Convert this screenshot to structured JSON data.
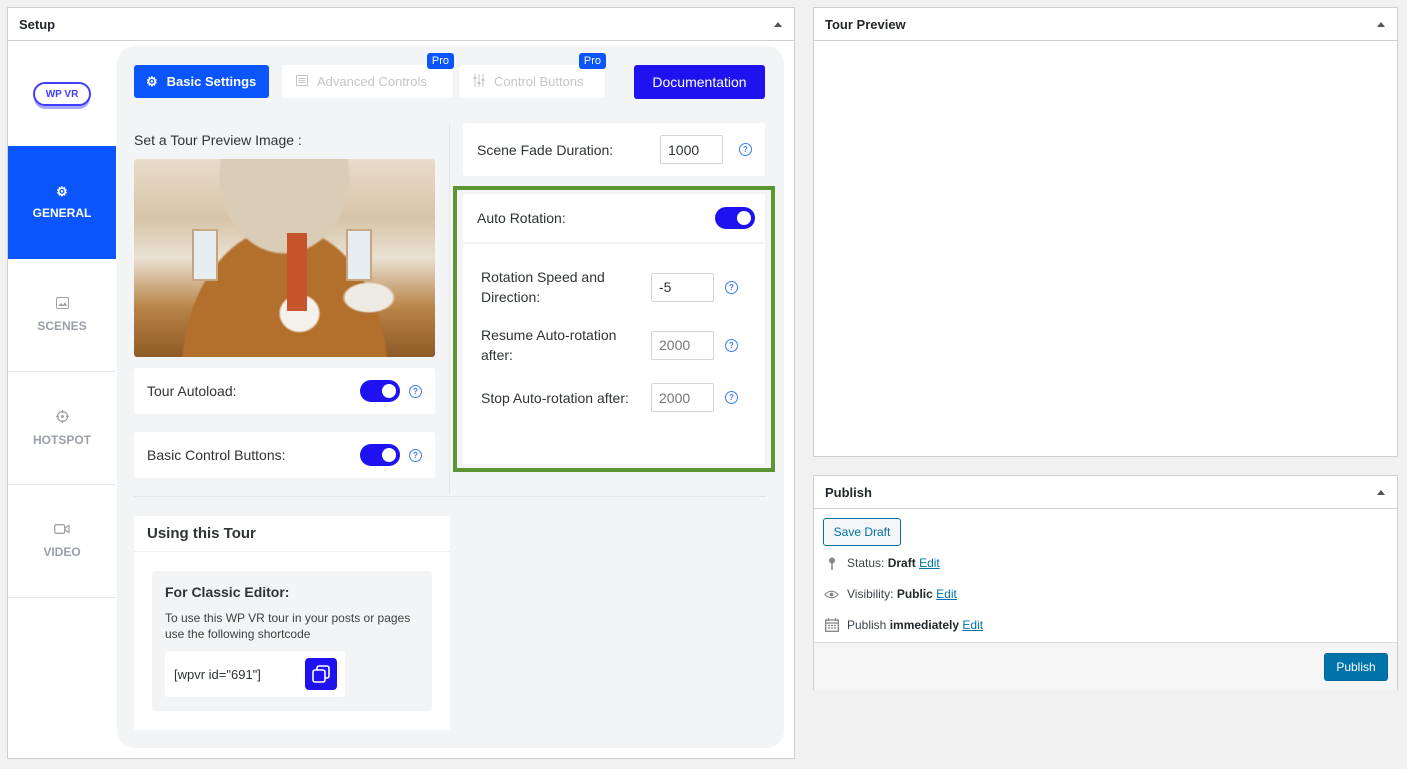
{
  "setup": {
    "title": "Setup",
    "logo_text": "WP VR",
    "nav": [
      {
        "label": "GENERAL",
        "icon": "gear-icon"
      },
      {
        "label": "SCENES",
        "icon": "image-icon"
      },
      {
        "label": "HOTSPOT",
        "icon": "crosshair-icon"
      },
      {
        "label": "VIDEO",
        "icon": "video-icon"
      }
    ],
    "tabs": {
      "basic": "Basic Settings",
      "advanced": "Advanced Controls",
      "control": "Control Buttons",
      "pro_badge": "Pro",
      "documentation": "Documentation"
    },
    "preview_label": "Set a Tour Preview Image :",
    "tour_autoload": {
      "label": "Tour Autoload:",
      "enabled": true
    },
    "basic_control_buttons": {
      "label": "Basic Control Buttons:",
      "enabled": true
    },
    "scene_fade": {
      "label": "Scene Fade Duration:",
      "value": "1000"
    },
    "auto_rotation": {
      "label": "Auto Rotation:",
      "enabled": true,
      "speed": {
        "label": "Rotation Speed and Direction:",
        "value": "-5"
      },
      "resume": {
        "label": "Resume Auto-rotation after:",
        "placeholder": "2000"
      },
      "stop": {
        "label": "Stop Auto-rotation after:",
        "placeholder": "2000"
      }
    },
    "using": {
      "title": "Using this Tour",
      "classic_title": "For Classic Editor:",
      "classic_text": "To use this WP VR tour in your posts or pages use the following shortcode",
      "shortcode": "[wpvr id=\"691\"]"
    },
    "help_glyph": "?"
  },
  "tour_preview": {
    "title": "Tour Preview"
  },
  "publish": {
    "title": "Publish",
    "save_draft": "Save Draft",
    "status_label": "Status:",
    "status_value": "Draft",
    "visibility_label": "Visibility:",
    "visibility_value": "Public",
    "schedule_label": "Publish",
    "schedule_value": "immediately",
    "edit": "Edit",
    "publish_button": "Publish"
  },
  "colors": {
    "accent": "#0b55ff",
    "toggle": "#1e13f0",
    "highlight_border": "#5b9632",
    "wp_primary": "#0073aa"
  }
}
